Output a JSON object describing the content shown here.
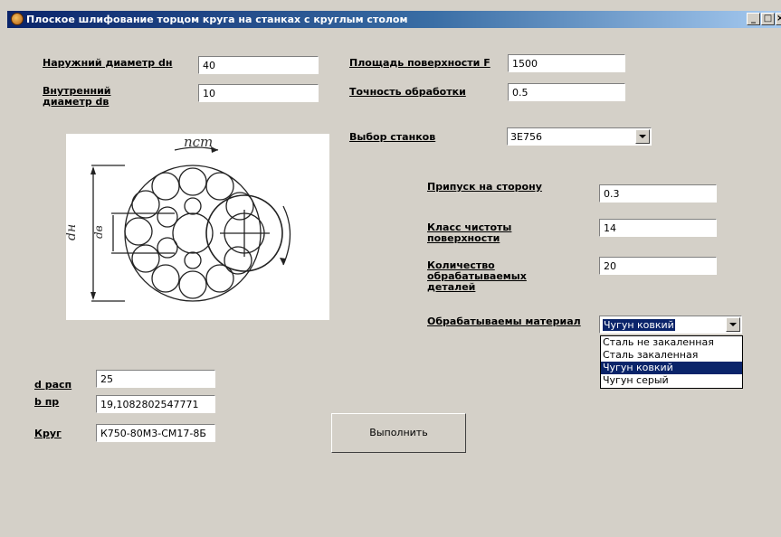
{
  "window": {
    "title": "Плоское шлифование торцом круга на станках с круглым столом",
    "minimize_label": "_",
    "maximize_label": "□",
    "close_label": "×"
  },
  "left": {
    "outer_diameter": {
      "label": "Наружний диаметр dн",
      "value": "40"
    },
    "inner_diameter": {
      "label": "Внутренний диаметр dв",
      "value": "10"
    }
  },
  "right": {
    "surface_area": {
      "label": "Площадь поверхности F",
      "value": "1500"
    },
    "accuracy": {
      "label": "Точность обработки",
      "value": "0.5"
    },
    "machine": {
      "label": "Выбор станков",
      "value": "3Е756"
    }
  },
  "params": {
    "allowance": {
      "label": "Припуск на сторону",
      "value": "0.3"
    },
    "surface_class": {
      "label": "Класс чистоты поверхности",
      "value": "14"
    },
    "part_count": {
      "label": "Количество обрабатываемых деталей",
      "value": "20"
    },
    "material": {
      "label": "Обрабатываемы материал",
      "value": "Чугун ковкий",
      "options": [
        "Сталь не закаленная",
        "Сталь закаленная",
        "Чугун ковкий",
        "Чугун серый"
      ]
    }
  },
  "results": {
    "d_rasp": {
      "label": "d расп",
      "value": "25"
    },
    "b_pr": {
      "label": "b пр",
      "value": "19,1082802547771"
    },
    "krug": {
      "label": "Круг",
      "value": "К750-80М3-СМ17-8Б"
    }
  },
  "actions": {
    "run_label": "Выполнить"
  },
  "diagram": {
    "n_label": "nст",
    "dn_label": "dн",
    "dv_label": "dв"
  }
}
